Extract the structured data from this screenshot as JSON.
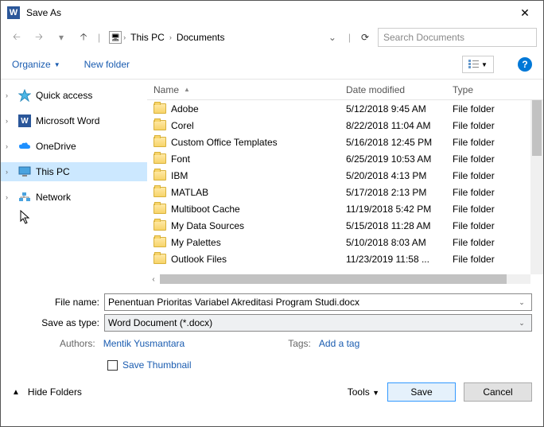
{
  "title": "Save As",
  "breadcrumb": {
    "root": "This PC",
    "folder": "Documents"
  },
  "search_placeholder": "Search Documents",
  "toolbar": {
    "organize": "Organize",
    "new_folder": "New folder"
  },
  "tree": [
    {
      "label": "Quick access",
      "icon": "star"
    },
    {
      "label": "Microsoft Word",
      "icon": "word"
    },
    {
      "label": "OneDrive",
      "icon": "cloud"
    },
    {
      "label": "This PC",
      "icon": "pc",
      "selected": true
    },
    {
      "label": "Network",
      "icon": "net"
    }
  ],
  "columns": {
    "name": "Name",
    "date": "Date modified",
    "type": "Type"
  },
  "rows": [
    {
      "name": "Adobe",
      "date": "5/12/2018 9:45 AM",
      "type": "File folder"
    },
    {
      "name": "Corel",
      "date": "8/22/2018 11:04 AM",
      "type": "File folder"
    },
    {
      "name": "Custom Office Templates",
      "date": "5/16/2018 12:45 PM",
      "type": "File folder"
    },
    {
      "name": "Font",
      "date": "6/25/2019 10:53 AM",
      "type": "File folder"
    },
    {
      "name": "IBM",
      "date": "5/20/2018 4:13 PM",
      "type": "File folder"
    },
    {
      "name": "MATLAB",
      "date": "5/17/2018 2:13 PM",
      "type": "File folder"
    },
    {
      "name": "Multiboot Cache",
      "date": "11/19/2018 5:42 PM",
      "type": "File folder"
    },
    {
      "name": "My Data Sources",
      "date": "5/15/2018 11:28 AM",
      "type": "File folder"
    },
    {
      "name": "My Palettes",
      "date": "5/10/2018 8:03 AM",
      "type": "File folder"
    },
    {
      "name": "Outlook Files",
      "date": "11/23/2019 11:58 ...",
      "type": "File folder"
    }
  ],
  "form": {
    "filename_label": "File name:",
    "filename_value": "Penentuan Prioritas Variabel Akreditasi Program Studi.docx",
    "type_label": "Save as type:",
    "type_value": "Word Document (*.docx)",
    "authors_label": "Authors:",
    "authors_value": "Mentik Yusmantara",
    "tags_label": "Tags:",
    "tags_value": "Add a tag",
    "thumb_label": "Save Thumbnail"
  },
  "footer": {
    "hide": "Hide Folders",
    "tools": "Tools",
    "save": "Save",
    "cancel": "Cancel"
  }
}
